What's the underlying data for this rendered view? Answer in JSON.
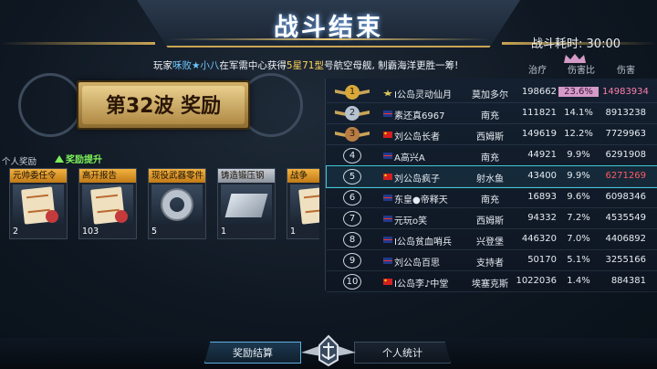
{
  "header": {
    "title": "战斗结束",
    "timer_label": "战斗耗时:",
    "timer_value": "30:00"
  },
  "marquee": {
    "prefix": "玩家",
    "player": "咊败★小八",
    "mid": "在军需中心获得",
    "item": "5星71型",
    "suffix": "号航空母舰, 制霸海洋更胜一筹!"
  },
  "wave": {
    "label": "第32波 奖励"
  },
  "rewards": {
    "section_label": "个人奖励",
    "upgrade_label": "奖励提升",
    "cards": [
      {
        "name": "元帅委任令",
        "count": "2",
        "icon": "document-icon"
      },
      {
        "name": "高开报告",
        "count": "103",
        "icon": "document-icon"
      },
      {
        "name": "现役武器零件",
        "count": "5",
        "icon": "gear-parts-icon"
      },
      {
        "name": "铸造锻压钢",
        "count": "1",
        "icon": "steel-plate-icon"
      },
      {
        "name": "战争",
        "count": "1",
        "icon": "document-icon"
      }
    ]
  },
  "ranking": {
    "headers": {
      "heal": "治疗",
      "pct": "伤害比",
      "dmg": "伤害"
    },
    "rows": [
      {
        "rank": "1",
        "name": "I公岛灵动仙月",
        "ship": "莫加多尔",
        "heal": "198662",
        "pct": "23.6%",
        "dmg": "14983934"
      },
      {
        "rank": "2",
        "name": "素还真6967",
        "ship": "南充",
        "heal": "111821",
        "pct": "14.1%",
        "dmg": "8913238"
      },
      {
        "rank": "3",
        "name": "刘公岛长者",
        "ship": "西姆斯",
        "heal": "149619",
        "pct": "12.2%",
        "dmg": "7729963"
      },
      {
        "rank": "4",
        "name": "A高兴A",
        "ship": "南充",
        "heal": "44921",
        "pct": "9.9%",
        "dmg": "6291908"
      },
      {
        "rank": "5",
        "name": "刘公岛疯子",
        "ship": "射水鱼",
        "heal": "43400",
        "pct": "9.9%",
        "dmg": "6271269"
      },
      {
        "rank": "6",
        "name": "东皇●帝释天",
        "ship": "南充",
        "heal": "16893",
        "pct": "9.6%",
        "dmg": "6098346"
      },
      {
        "rank": "7",
        "name": "元玩o笑",
        "ship": "西姆斯",
        "heal": "94332",
        "pct": "7.2%",
        "dmg": "4535549"
      },
      {
        "rank": "8",
        "name": "I公岛贫血哨兵",
        "ship": "兴登堡",
        "heal": "446320",
        "pct": "7.0%",
        "dmg": "4406892"
      },
      {
        "rank": "9",
        "name": "刘公岛百思",
        "ship": "支持者",
        "heal": "50170",
        "pct": "5.1%",
        "dmg": "3255166"
      },
      {
        "rank": "10",
        "name": "I公岛李♪中堂",
        "ship": "埃塞克斯",
        "heal": "1022036",
        "pct": "1.4%",
        "dmg": "884381"
      }
    ]
  },
  "nav": {
    "left_label": "奖励结算",
    "right_label": "个人统计"
  },
  "colors": {
    "gold": "#c9a555",
    "highlight": "#3fc8d9",
    "top_pct": "#d49ac8"
  }
}
